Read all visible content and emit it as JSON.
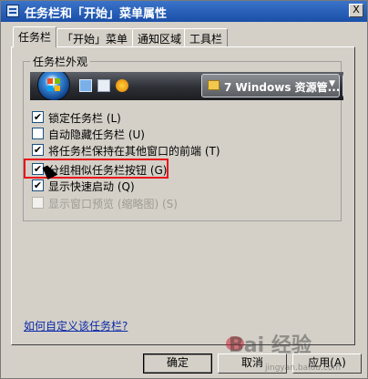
{
  "window": {
    "title": "任务栏和「开始」菜单属性",
    "close_symbol": "X"
  },
  "tabs": [
    {
      "label": "任务栏",
      "active": true
    },
    {
      "label": "「开始」菜单",
      "active": false
    },
    {
      "label": "通知区域",
      "active": false
    },
    {
      "label": "工具栏",
      "active": false
    }
  ],
  "group": {
    "label": "任务栏外观"
  },
  "preview": {
    "task_button_label": "7 Windows 资源管...",
    "task_button_arrow": "▼",
    "quicklaunch_icons": [
      "desktop-icon",
      "window-icon",
      "mediaplayer-icon"
    ]
  },
  "options": [
    {
      "label": "锁定任务栏 (L)",
      "checked": true,
      "enabled": true
    },
    {
      "label": "自动隐藏任务栏 (U)",
      "checked": false,
      "enabled": true
    },
    {
      "label": "将任务栏保持在其他窗口的前端 (T)",
      "checked": true,
      "enabled": true
    },
    {
      "label": "分组相似任务栏按钮 (G)",
      "checked": true,
      "enabled": true
    },
    {
      "label": "显示快速启动 (Q)",
      "checked": true,
      "enabled": true
    },
    {
      "label": "显示窗口预览 (缩略图) (S)",
      "checked": false,
      "enabled": false
    }
  ],
  "help_link": "如何自定义该任务栏?",
  "buttons": {
    "ok": "确定",
    "cancel": "取消",
    "apply": "应用(A)"
  },
  "watermark": {
    "text": "Bai 经验",
    "url": "jingyan.baidu.com"
  },
  "colors": {
    "highlight": "#e8141b",
    "titlebar": "#1a4fa8",
    "link": "#0a2aa8"
  }
}
